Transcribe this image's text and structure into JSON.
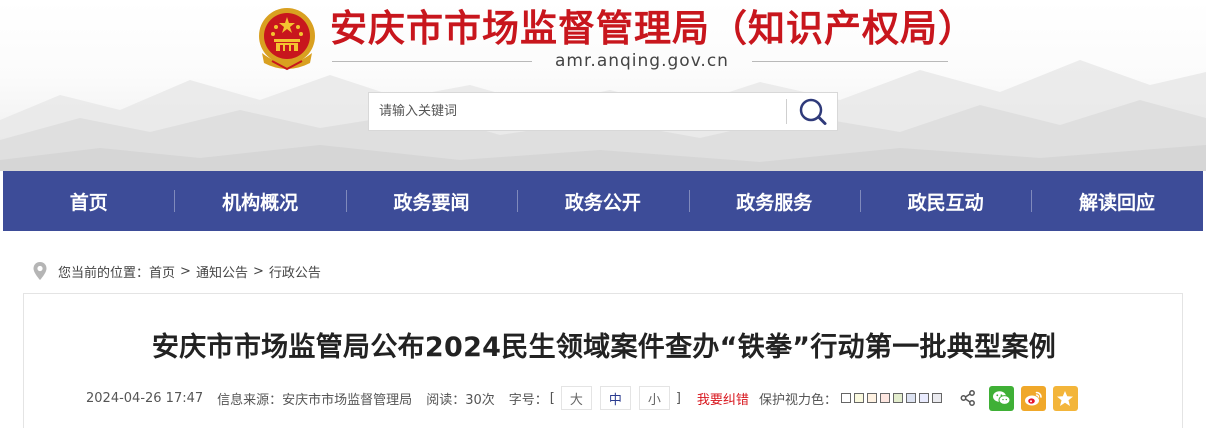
{
  "header": {
    "site_title": "安庆市市场监督管理局（知识产权局）",
    "domain": "amr.anqing.gov.cn",
    "emblem_icon": "national-emblem-icon",
    "brand_color": "#c8161d"
  },
  "search": {
    "placeholder": "请输入关键词",
    "button_icon": "search-icon"
  },
  "nav": {
    "background": "#3d4c98",
    "items": [
      {
        "label": "首页"
      },
      {
        "label": "机构概况"
      },
      {
        "label": "政务要闻"
      },
      {
        "label": "政务公开"
      },
      {
        "label": "政务服务"
      },
      {
        "label": "政民互动"
      },
      {
        "label": "解读回应"
      }
    ]
  },
  "breadcrumb": {
    "prefix": "您当前的位置：",
    "items": [
      {
        "label": "首页"
      },
      {
        "label": "通知公告"
      },
      {
        "label": "行政公告"
      }
    ],
    "separator": ">"
  },
  "article": {
    "title": "安庆市市场监管局公布2024民生领域案件查办“铁拳”行动第一批典型案例",
    "meta": {
      "datetime": "2024-04-26 17:47",
      "source_label": "信息来源：",
      "source": "安庆市市场监督管理局",
      "views_label": "阅读：",
      "views": "30次",
      "font_label": "字号：",
      "bracket_open": "[",
      "bracket_close": "]",
      "font_sizes": [
        "大",
        "中",
        "小"
      ],
      "error_report": "我要纠错",
      "eye_care_label": "保护视力色：",
      "eye_care_colors": [
        "#ffffff",
        "#faf9de",
        "#fff2e2",
        "#fde6e0",
        "#e3edcd",
        "#dce2f1",
        "#e9ebfe",
        "#eaeaef"
      ]
    },
    "share": {
      "share_icon": "share-icon",
      "platforms": [
        {
          "icon": "wechat-icon",
          "color": "#3fb036"
        },
        {
          "icon": "weibo-icon",
          "color": "#f0a82a"
        },
        {
          "icon": "qzone-star-icon",
          "color": "#f3b53a"
        }
      ]
    }
  }
}
